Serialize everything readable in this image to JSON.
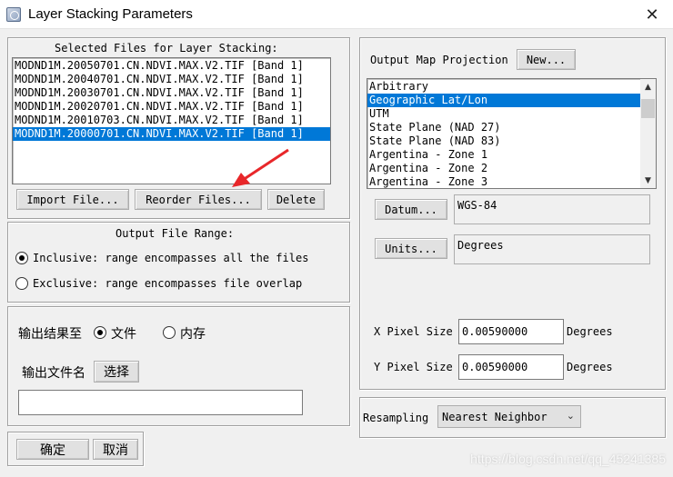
{
  "window": {
    "title": "Layer Stacking Parameters",
    "close_glyph": "✕"
  },
  "files": {
    "heading": "Selected Files for Layer Stacking:",
    "items": [
      "MODND1M.20050701.CN.NDVI.MAX.V2.TIF [Band 1]",
      "MODND1M.20040701.CN.NDVI.MAX.V2.TIF [Band 1]",
      "MODND1M.20030701.CN.NDVI.MAX.V2.TIF [Band 1]",
      "MODND1M.20020701.CN.NDVI.MAX.V2.TIF [Band 1]",
      "MODND1M.20010703.CN.NDVI.MAX.V2.TIF [Band 1]",
      "MODND1M.20000701.CN.NDVI.MAX.V2.TIF [Band 1]"
    ],
    "selected_index": 5,
    "import_label": "Import File...",
    "reorder_label": "Reorder Files...",
    "delete_label": "Delete"
  },
  "range": {
    "heading": "Output File Range:",
    "inclusive_label": "Inclusive: range encompasses all the files",
    "exclusive_label": "Exclusive: range encompasses file overlap",
    "selected": "inclusive"
  },
  "output": {
    "output_to_label": "输出结果至",
    "file_label": "文件",
    "memory_label": "内存",
    "selected": "file",
    "filename_label": "输出文件名",
    "choose_label": "选择",
    "filename_value": ""
  },
  "actions": {
    "ok_label": "确定",
    "cancel_label": "取消"
  },
  "projection": {
    "label": "Output Map Projection",
    "new_label": "New...",
    "items": [
      "Arbitrary",
      "Geographic Lat/Lon",
      "UTM",
      "State Plane (NAD 27)",
      "State Plane (NAD 83)",
      "Argentina - Zone 1",
      "Argentina - Zone 2",
      "Argentina - Zone 3"
    ],
    "selected_index": 1,
    "datum_label": "Datum...",
    "datum_value": "WGS-84",
    "units_label": "Units...",
    "units_value": "Degrees"
  },
  "pixel": {
    "x_label": "X Pixel Size",
    "x_value": "0.00590000",
    "x_unit": "Degrees",
    "y_label": "Y Pixel Size",
    "y_value": "0.00590000",
    "y_unit": "Degrees"
  },
  "resampling": {
    "label": "Resampling",
    "value": "Nearest Neighbor"
  },
  "watermark": "https://blog.csdn.net/qq_45241385",
  "colors": {
    "selection": "#0078d7",
    "annotation_arrow": "#e8272a"
  }
}
